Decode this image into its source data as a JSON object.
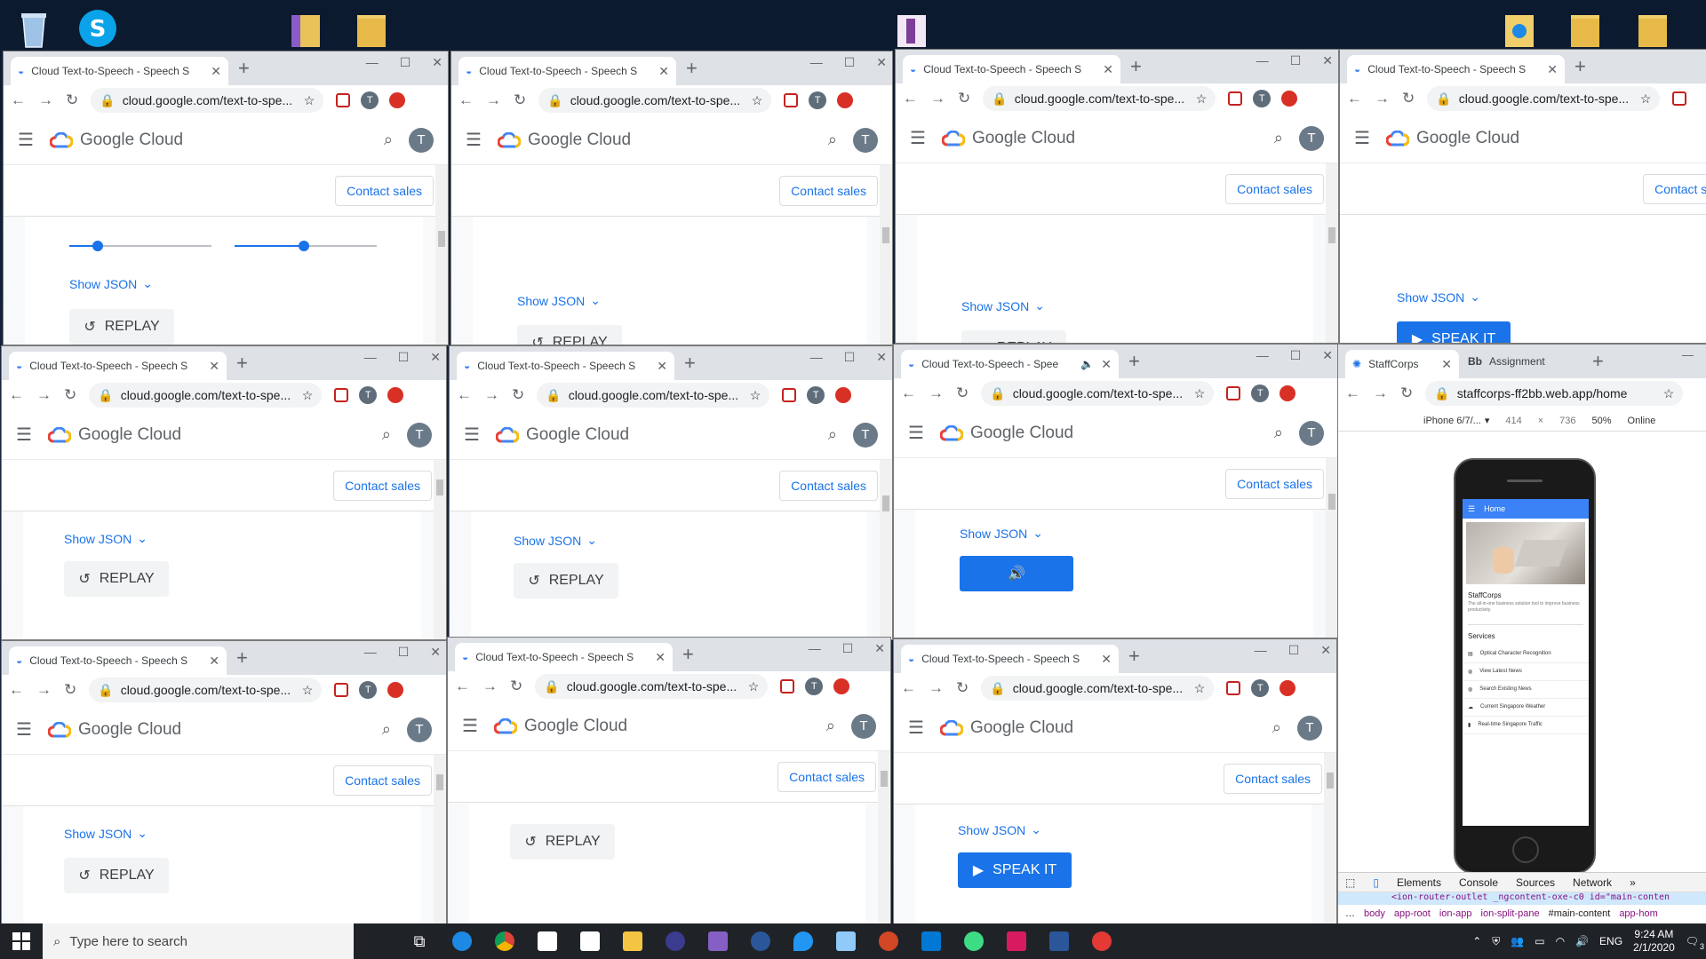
{
  "desktop": {
    "icons": [
      "recycle-bin-icon",
      "skype-icon",
      "folder-icon",
      "folder-icon",
      "folder-icon",
      "folder-icon",
      "folder-icon",
      "folder-icon"
    ]
  },
  "gc_window": {
    "tab_title": "Cloud Text-to-Speech - Speech S",
    "tab_title_short": "Cloud Text-to-Speech - Spee",
    "url": "cloud.google.com/text-to-spe...",
    "brand": "Google Cloud",
    "avatar_letter": "T",
    "contact_sales": "Contact sales",
    "show_json": "Show JSON",
    "replay": "REPLAY",
    "speak_it": "SPEAK IT"
  },
  "staffcorps_window": {
    "tab1": "StaffCorps",
    "tab2": "Assignment",
    "url": "staffcorps-ff2bb.web.app/home",
    "device": "iPhone 6/7/...",
    "width": "414",
    "times": "×",
    "height": "736",
    "zoom": "50%",
    "network": "Online",
    "app_header": "Home",
    "app_title": "StaffCorps",
    "app_subtitle": "The all-in-one business solution tool to improve business productivity.",
    "services_heading": "Services",
    "services": [
      "Optical Character Recognition",
      "View Latest News",
      "Search Existing News",
      "Current Singapore Weather",
      "Real-time Singapore Traffic"
    ],
    "devtools_tabs": [
      "Elements",
      "Console",
      "Sources",
      "Network"
    ],
    "breadcrumb": [
      "body",
      "app-root",
      "ion-app",
      "ion-split-pane",
      "#main-content",
      "app-hom"
    ],
    "dom_line": "<ion-router-outlet _ngcontent-oxe-c0 id=\"main-conten"
  },
  "taskbar": {
    "search_placeholder": "Type here to search",
    "language": "ENG",
    "time": "9:24 AM",
    "date": "2/1/2020",
    "notif_count": "3"
  }
}
